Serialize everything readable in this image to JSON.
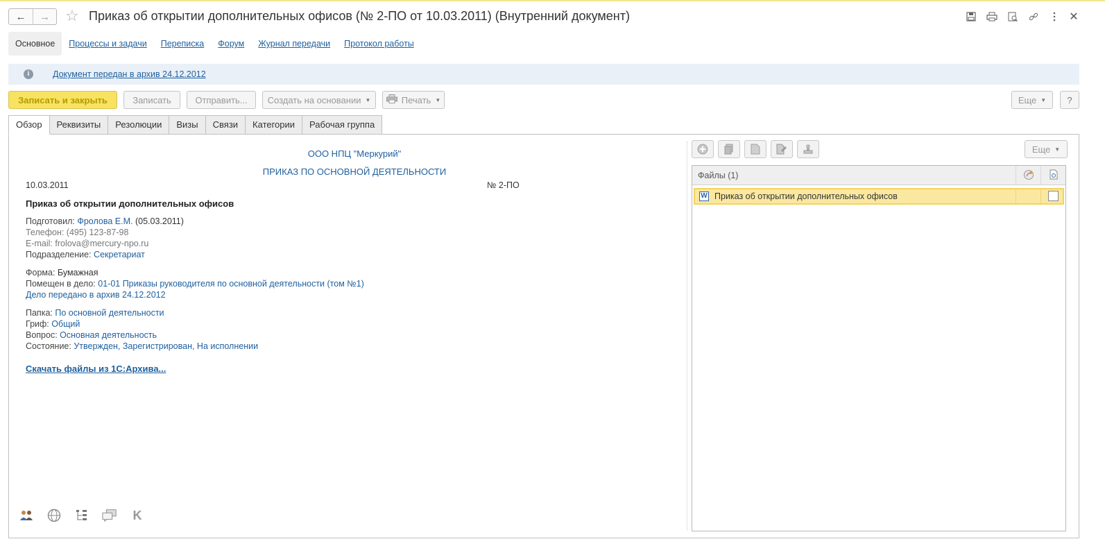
{
  "window": {
    "title": "Приказ об открытии дополнительных офисов (№ 2-ПО от 10.03.2011) (Внутренний документ)",
    "nav_back_icon": "arrow-left",
    "nav_forward_icon": "arrow-right",
    "favorite_icon": "star"
  },
  "sections": [
    {
      "label": "Основное"
    },
    {
      "label": "Процессы и задачи"
    },
    {
      "label": "Переписка"
    },
    {
      "label": "Форум"
    },
    {
      "label": "Журнал передачи"
    },
    {
      "label": "Протокол работы"
    }
  ],
  "info": {
    "text": "Документ передан в архив 24.12.2012"
  },
  "toolbar": {
    "save_close": "Записать и закрыть",
    "save": "Записать",
    "send": "Отправить...",
    "create_based": "Создать на основании",
    "print": "Печать",
    "more": "Еще",
    "help": "?"
  },
  "tabs": [
    {
      "label": "Обзор"
    },
    {
      "label": "Реквизиты"
    },
    {
      "label": "Резолюции"
    },
    {
      "label": "Визы"
    },
    {
      "label": "Связи"
    },
    {
      "label": "Категории"
    },
    {
      "label": "Рабочая группа"
    }
  ],
  "preview": {
    "org": "ООО НПЦ \"Меркурий\"",
    "kind": "ПРИКАЗ ПО ОСНОВНОЙ ДЕЯТЕЛЬНОСТИ",
    "date": "10.03.2011",
    "number": "№ 2-ПО",
    "subject": "Приказ об открытии дополнительных офисов",
    "prepared_label": "Подготовил:",
    "prepared_value": "Фролова Е.М.",
    "prepared_date": "(05.03.2011)",
    "phone": "Телефон: (495) 123-87-98",
    "email": "E-mail: frolova@mercury-npo.ru",
    "department_label": "Подразделение:",
    "department_value": "Секретариат",
    "form_label": "Форма:",
    "form_value": "Бумажная",
    "case_label": "Помещен в дело:",
    "case_value": "01-01 Приказы руководителя по основной деятельности (том №1)",
    "case_archived": "Дело передано в архив 24.12.2012",
    "folder_label": "Папка:",
    "folder_value": "По основной деятельности",
    "stamp_label": "Гриф:",
    "stamp_value": "Общий",
    "question_label": "Вопрос:",
    "question_value": "Основная деятельность",
    "state_label": "Состояние:",
    "state_value": "Утвержден, Зарегистрирован, На исполнении",
    "download_link": "Скачать файлы из 1С:Архива..."
  },
  "files": {
    "more": "Еще",
    "header": "Файлы (1)",
    "rows": [
      {
        "name": "Приказ об открытии дополнительных офисов",
        "type_icon": "word-icon",
        "checked": false
      }
    ]
  },
  "bottom_icons": [
    "users-icon",
    "globe-icon",
    "tree-icon",
    "comments-icon",
    "k-icon"
  ],
  "colors": {
    "accent_yellow": "#f7e261",
    "link_blue": "#1f5f9e",
    "selected_row": "#fbe8a0"
  }
}
